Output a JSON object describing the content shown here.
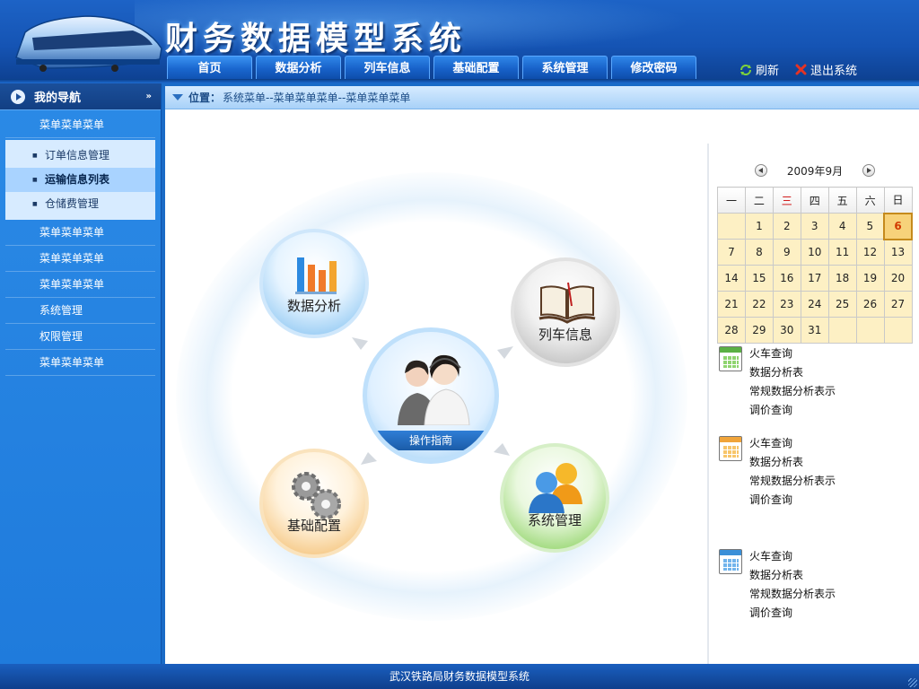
{
  "header": {
    "title": "财务数据模型系统",
    "tabs": [
      {
        "label": "首页"
      },
      {
        "label": "数据分析"
      },
      {
        "label": "列车信息"
      },
      {
        "label": "基础配置"
      },
      {
        "label": "系统管理"
      },
      {
        "label": "修改密码"
      }
    ],
    "refresh_label": "刷新",
    "exit_label": "退出系统"
  },
  "sidebar": {
    "heading": "我的导航",
    "items_top": [
      {
        "label": "菜单菜单菜单"
      }
    ],
    "subitems": [
      {
        "label": "订单信息管理"
      },
      {
        "label": "运输信息列表"
      },
      {
        "label": "仓储费管理"
      }
    ],
    "items_bottom": [
      {
        "label": "菜单菜单菜单"
      },
      {
        "label": "菜单菜单菜单"
      },
      {
        "label": "菜单菜单菜单"
      },
      {
        "label": "系统管理"
      },
      {
        "label": "权限管理"
      },
      {
        "label": "菜单菜单菜单"
      }
    ]
  },
  "location": {
    "prefix": "位置：",
    "path": "系统菜单--菜单菜单菜单--菜单菜单菜单"
  },
  "diagram": {
    "data_analysis": "数据分析",
    "train_info": "列车信息",
    "base_config": "基础配置",
    "system_mgmt": "系统管理",
    "guide": "操作指南"
  },
  "calendar": {
    "month_label": "2009年9月",
    "weekdays": [
      "一",
      "二",
      "三",
      "四",
      "五",
      "六",
      "日"
    ],
    "weeks": [
      [
        "",
        "1",
        "2",
        "3",
        "4",
        "5",
        "6"
      ],
      [
        "7",
        "8",
        "9",
        "10",
        "11",
        "12",
        "13"
      ],
      [
        "14",
        "15",
        "16",
        "17",
        "18",
        "19",
        "20"
      ],
      [
        "21",
        "22",
        "23",
        "24",
        "25",
        "26",
        "27"
      ],
      [
        "28",
        "29",
        "30",
        "31",
        "",
        "",
        ""
      ]
    ],
    "today": "6"
  },
  "link_groups": [
    {
      "icon": "green-spreadsheet-icon",
      "color": "#5bb044",
      "items": [
        "火车查询",
        "数据分析表",
        "常规数据分析表示",
        "调价查询"
      ]
    },
    {
      "icon": "orange-spreadsheet-icon",
      "color": "#f0a43a",
      "items": [
        "火车查询",
        "数据分析表",
        "常规数据分析表示",
        "调价查询"
      ]
    },
    {
      "icon": "blue-spreadsheet-icon",
      "color": "#3a8fd8",
      "items": [
        "火车查询",
        "数据分析表",
        "常规数据分析表示",
        "调价查询"
      ]
    }
  ],
  "footer": {
    "text": "武汉铁路局财务数据模型系统"
  }
}
